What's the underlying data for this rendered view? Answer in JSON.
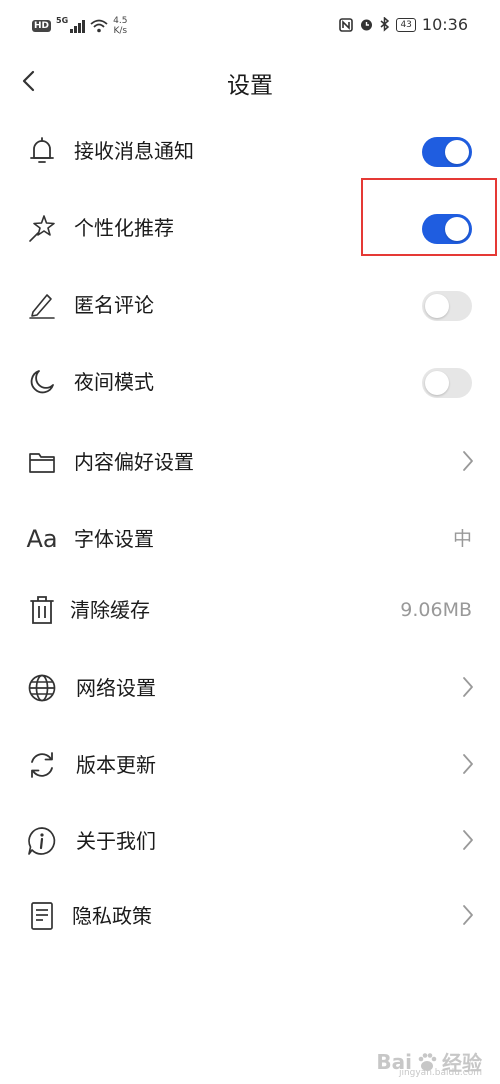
{
  "status_bar": {
    "network_badge": "HD",
    "network_type": "5G",
    "speed_value": "4.5",
    "speed_unit": "K/s",
    "battery": "43",
    "time": "10:36"
  },
  "header": {
    "title": "设置",
    "back_icon": "chevron-left-icon"
  },
  "settings": {
    "items": [
      {
        "label": "接收消息通知",
        "icon": "bell-icon",
        "control": "toggle",
        "on": true
      },
      {
        "label": "个性化推荐",
        "icon": "sparkle-star-icon",
        "control": "toggle",
        "on": true
      },
      {
        "label": "匿名评论",
        "icon": "pen-icon",
        "control": "toggle",
        "on": false
      },
      {
        "label": "夜间模式",
        "icon": "moon-icon",
        "control": "toggle",
        "on": false
      },
      {
        "label": "内容偏好设置",
        "icon": "folder-icon",
        "control": "chevron"
      },
      {
        "label": "字体设置",
        "icon": "font-aa-icon",
        "icon_text": "Aa",
        "control": "value",
        "value": "中"
      },
      {
        "label": "清除缓存",
        "icon": "trash-icon",
        "control": "value",
        "value": "9.06MB"
      },
      {
        "label": "网络设置",
        "icon": "globe-icon",
        "control": "chevron"
      },
      {
        "label": "版本更新",
        "icon": "refresh-icon",
        "control": "chevron"
      },
      {
        "label": "关于我们",
        "icon": "info-icon",
        "control": "chevron"
      },
      {
        "label": "隐私政策",
        "icon": "document-icon",
        "control": "chevron"
      }
    ]
  },
  "colors": {
    "toggle_on": "#1f5de0",
    "toggle_off": "#e6e6e6",
    "highlight": "#e53935"
  },
  "watermark": {
    "brand": "Bai",
    "brand2": "经验",
    "url": "jingyan.baidu.com"
  }
}
